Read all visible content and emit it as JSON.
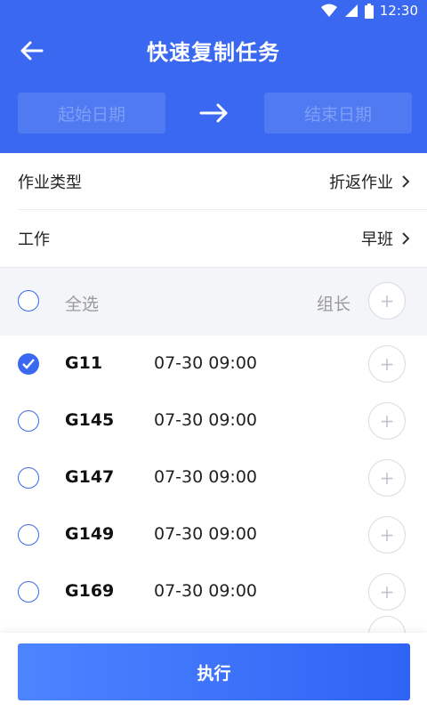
{
  "status_bar": {
    "time": "12:30",
    "icons": [
      "wifi-icon",
      "signal-icon",
      "battery-icon"
    ]
  },
  "header": {
    "title": "快速复制任务",
    "start_date_placeholder": "起始日期",
    "end_date_placeholder": "结束日期"
  },
  "form": {
    "work_type_label": "作业类型",
    "work_type_value": "折返作业",
    "shift_label": "工作",
    "shift_value": "早班"
  },
  "select_all": {
    "label": "全选",
    "leader_label": "组长",
    "add_label": "+"
  },
  "tasks": [
    {
      "code": "G11",
      "time": "07-30 09:00",
      "checked": true,
      "add_label": "+"
    },
    {
      "code": "G145",
      "time": "07-30 09:00",
      "checked": false,
      "add_label": "+"
    },
    {
      "code": "G147",
      "time": "07-30 09:00",
      "checked": false,
      "add_label": "+"
    },
    {
      "code": "G149",
      "time": "07-30 09:00",
      "checked": false,
      "add_label": "+"
    },
    {
      "code": "G169",
      "time": "07-30 09:00",
      "checked": false,
      "add_label": "+"
    }
  ],
  "footer": {
    "execute_label": "执行"
  },
  "colors": {
    "primary": "#3a68f0",
    "date_box": "#4f7af2",
    "button_start": "#4d84ff",
    "button_end": "#2f63f5"
  }
}
